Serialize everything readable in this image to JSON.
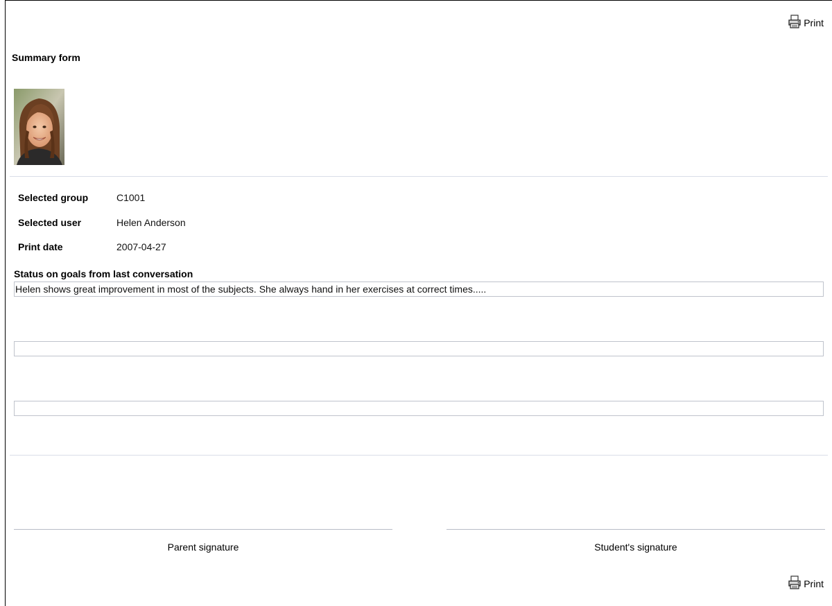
{
  "print_top": {
    "label": "Print",
    "icon": "printer-icon"
  },
  "print_bottom": {
    "label": "Print",
    "icon": "printer-icon"
  },
  "page_title": "Summary form",
  "photo": {
    "icon": "student-photo"
  },
  "info": {
    "group_label": "Selected group",
    "group_value": "C1001",
    "user_label": "Selected user",
    "user_value": "Helen Anderson",
    "date_label": "Print date",
    "date_value": "2007-04-27"
  },
  "status": {
    "title": "Status on goals from last conversation",
    "field1_value": "Helen shows great improvement in most of the subjects. She always hand in her exercises at correct times.....",
    "field2_value": "",
    "field3_value": ""
  },
  "signatures": {
    "parent_label": "Parent signature",
    "student_label": "Student's signature"
  }
}
